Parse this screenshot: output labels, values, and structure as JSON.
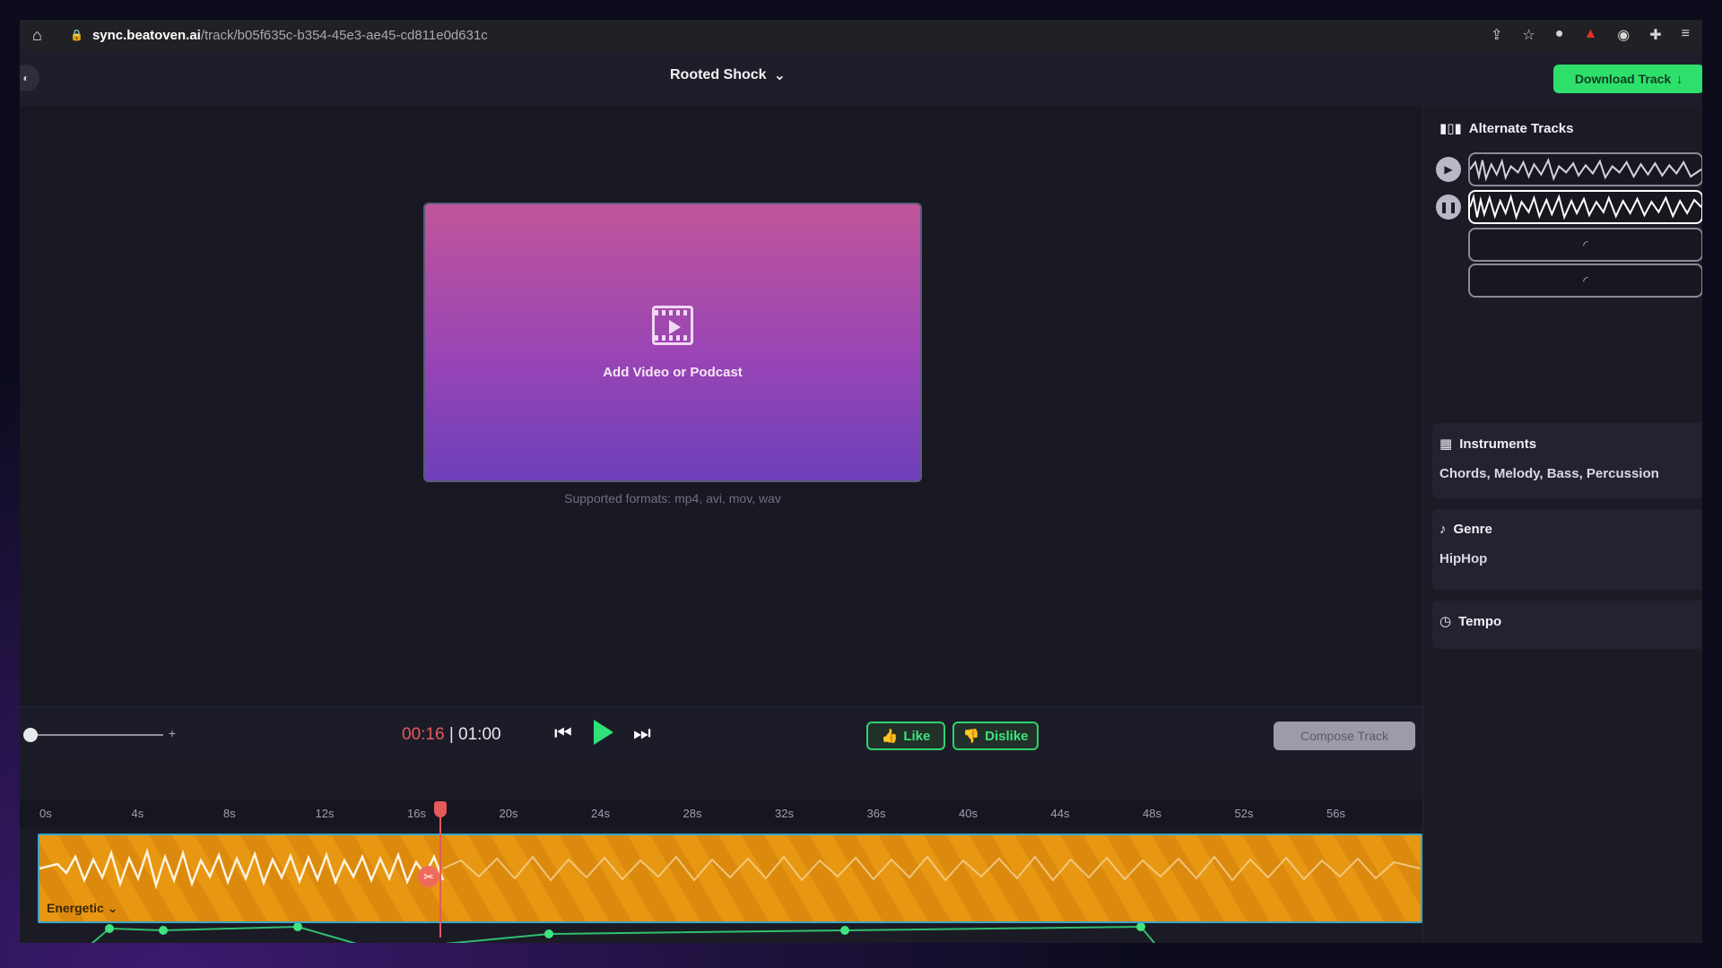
{
  "browser": {
    "url_host": "sync.beatoven.ai",
    "url_path": "/track/b05f635c-b354-45e3-ae45-cd811e0d631c"
  },
  "header": {
    "track_title": "Rooted Shock",
    "download_label": "Download Track"
  },
  "stage": {
    "upload_label": "Add Video or Podcast",
    "formats": "Supported formats: mp4, avi, mov, wav"
  },
  "panel": {
    "alternate_title": "Alternate Tracks",
    "instruments_title": "Instruments",
    "instruments_value": "Chords, Melody, Bass, Percussion",
    "genre_title": "Genre",
    "genre_value": "HipHop",
    "tempo_title": "Tempo"
  },
  "transport": {
    "current_time": "00:16",
    "separator": "|",
    "total_time": "01:00",
    "like_label": "Like",
    "dislike_label": "Dislike",
    "compose_label": "Compose Track"
  },
  "timeline": {
    "ticks": [
      "0s",
      "4s",
      "8s",
      "12s",
      "16s",
      "20s",
      "24s",
      "28s",
      "32s",
      "36s",
      "40s",
      "44s",
      "48s",
      "52s",
      "56s"
    ],
    "mood": "Energetic"
  },
  "colors": {
    "accent_green": "#2ee06b",
    "track_orange": "#e89712",
    "playhead_red": "#e55a5a"
  }
}
